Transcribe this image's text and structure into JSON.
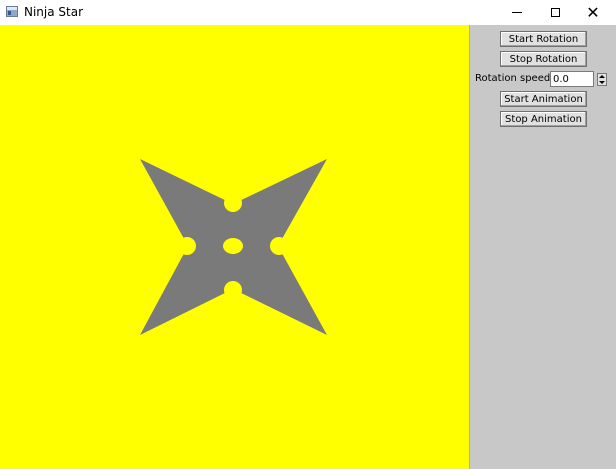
{
  "window": {
    "title": "Ninja Star",
    "controls": {
      "minimize_icon": "minimize-icon",
      "maximize_icon": "maximize-icon",
      "close_icon": "close-icon"
    }
  },
  "canvas": {
    "background_color": "#ffff00",
    "shape": "ninja-star",
    "shape_color": "#7a7a7a"
  },
  "panel": {
    "background_color": "#c8c8c8",
    "start_rotation_label": "Start Rotation",
    "stop_rotation_label": "Stop Rotation",
    "rotation_speed_label": "Rotation speed",
    "rotation_speed_value": "0.0",
    "start_animation_label": "Start Animation",
    "stop_animation_label": "Stop Animation"
  }
}
